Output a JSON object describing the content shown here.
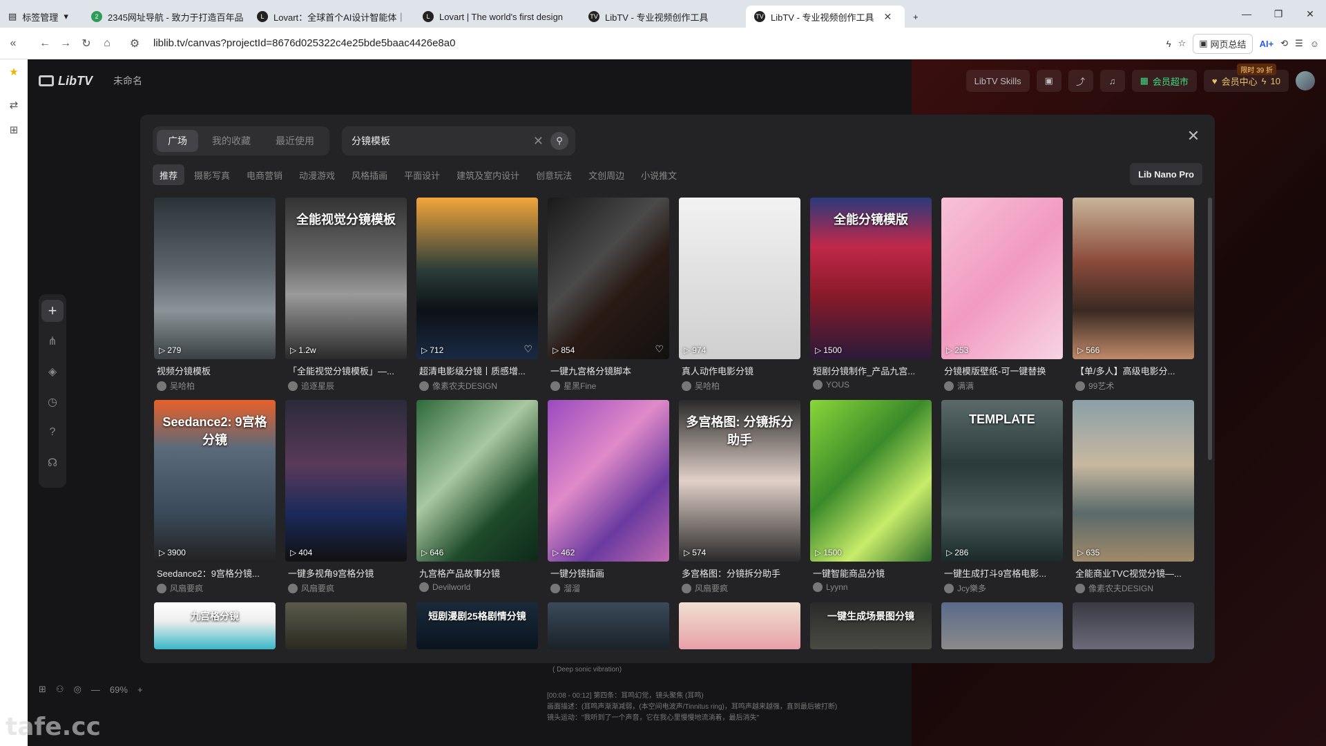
{
  "browser": {
    "tabs": [
      {
        "label": "标签管理",
        "favicon": ""
      },
      {
        "label": "2345网址导航 - 致力于打造百年品",
        "favicon": "2"
      },
      {
        "label": "Lovart：全球首个AI设计智能体｜",
        "favicon": "L"
      },
      {
        "label": "Lovart | The world's first design",
        "favicon": "L"
      },
      {
        "label": "LibTV - 专业视频创作工具",
        "favicon": "TV"
      },
      {
        "label": "LibTV - 专业视频创作工具",
        "favicon": "TV"
      }
    ],
    "url": "liblib.tv/canvas?projectId=8676d025322c4e25bde5baac4426e8a0",
    "web_summary": "网页总结",
    "ai_label": "AI+"
  },
  "app": {
    "logo": "LibTV",
    "project_name": "未命名",
    "skills": "LibTV Skills",
    "vip": "会员超市",
    "member_center": "会员中心",
    "credits": "10",
    "badge": "限时 39 折",
    "zoom": "69%",
    "bg_text_1": "( Deep sonic vibration)",
    "bg_text_2": "[00:08 - 00:12] 第四条：耳鸣幻觉，镜头聚焦 (耳鸣)",
    "bg_text_3": "画面描述：(耳鸣声渐渐减弱，(本空间电波声/Tinnitus ring)，耳鸣声越来越强，直到最后被打断)",
    "bg_text_4": "镜头运动：\"我听到了一个声音，它在我心里慢慢地流淌着，最后消失\"",
    "watermark": "tafe.cc"
  },
  "modal": {
    "tabs": [
      "广场",
      "我的收藏",
      "最近使用"
    ],
    "search_value": "分镜模板",
    "categories": [
      "推荐",
      "摄影写真",
      "电商营销",
      "动漫游戏",
      "风格插画",
      "平面设计",
      "建筑及室内设计",
      "创意玩法",
      "文创周边",
      "小说推文"
    ],
    "model": "Lib Nano Pro",
    "cards": [
      {
        "title": "视频分镜模板",
        "author": "吴哈柏",
        "stat": "279",
        "bg": "linear-gradient(180deg,#2c3338,#5c656b 45%,#8b9498 70%,#3a4044)",
        "overlay": ""
      },
      {
        "title": "「全能视觉分镜模板」—...",
        "author": "追逐星辰",
        "stat": "1.2w",
        "bg": "linear-gradient(180deg,#333,#6a6a6a 40%,#9a9a9a 60%,#2a2a2a)",
        "overlay": "全能视觉分镜模板"
      },
      {
        "title": "超清电影级分镜丨质感增...",
        "author": "像素农夫DESIGN",
        "stat": "712",
        "bg": "linear-gradient(180deg,#f2a63c,#2a3c38 45%,#0c1116 70%,#1a2a44)",
        "overlay": ""
      },
      {
        "title": "一键九宫格分镜脚本",
        "author": "星黑Fine",
        "stat": "854",
        "bg": "linear-gradient(135deg,#1a1a1a,#4a4a4a 40%,#2a1a14 60%,#111)",
        "overlay": ""
      },
      {
        "title": "真人动作电影分镜",
        "author": "吴哈柏",
        "stat": "974",
        "bg": "linear-gradient(180deg,#f2f2f2,#e0e0e0 50%,#cfcfcf)",
        "overlay": ""
      },
      {
        "title": "短剧分镜制作_产品九宫...",
        "author": "YOUS",
        "stat": "1500",
        "bg": "linear-gradient(180deg,#2a3a7a,#c0284a 30%,#8a1a2a 60%,#2a1a3a)",
        "overlay": "全能分镜模版"
      },
      {
        "title": "分镜模版壁纸-可一键替换",
        "author": "满满",
        "stat": "253",
        "bg": "linear-gradient(135deg,#f7c2d8,#f29ac0 50%,#f7d4e4)",
        "overlay": ""
      },
      {
        "title": "【单/多人】高级电影分...",
        "author": "99艺术",
        "stat": "566",
        "bg": "linear-gradient(180deg,#c8b49a,#8a4a3a 40%,#3a2a22 70%,#c08a6a)",
        "overlay": ""
      },
      {
        "title": "Seedance2：9宫格分镜...",
        "author": "风扇要疯",
        "stat": "3900",
        "bg": "linear-gradient(180deg,#e8602a,#5a6a7a 30%,#3a4a5a 70%,#222)",
        "overlay": "Seedance2: 9宫格分镜"
      },
      {
        "title": "一键多视角9宫格分镜",
        "author": "风扇要疯",
        "stat": "404",
        "bg": "linear-gradient(180deg,#2a2a3a,#5a3a5a 40%,#1a2a5a 70%,#111)",
        "overlay": ""
      },
      {
        "title": "九宫格产品故事分镜",
        "author": "Devilworld",
        "stat": "646",
        "bg": "linear-gradient(135deg,#2e6a3a,#a8c8a0 40%,#1e4a2a 70%,#0e2a1a)",
        "overlay": ""
      },
      {
        "title": "一键分镜插画",
        "author": "溜溜",
        "stat": "462",
        "bg": "linear-gradient(135deg,#9a4ac0,#e08ac8 40%,#6a3aa0 70%,#c06ab0)",
        "overlay": ""
      },
      {
        "title": "多宫格图：分镜拆分助手",
        "author": "风扇要疯",
        "stat": "574",
        "bg": "linear-gradient(180deg,#2a2a2a,#e0d0c8 50%,#2a2a2a)",
        "overlay": "多宫格图: 分镜拆分助手"
      },
      {
        "title": "一键智能商品分镜",
        "author": "Lyynn",
        "stat": "1500",
        "bg": "linear-gradient(135deg,#8ad63a,#3a8a2a 40%,#c8ec6a 70%,#2a6a2a)",
        "overlay": ""
      },
      {
        "title": "一键生成打斗9宫格电影...",
        "author": "Jcy樂多",
        "stat": "286",
        "bg": "linear-gradient(180deg,#5a6a6a,#2a3a3a 40%,#4a5a5a 70%,#1a2a2a)",
        "overlay": "TEMPLATE"
      },
      {
        "title": "全能商业TVC视觉分镜—...",
        "author": "像素农夫DESIGN",
        "stat": "635",
        "bg": "linear-gradient(180deg,#8aa0a8,#c8b8a0 40%,#5a6a6a 70%,#a08a6a)",
        "overlay": ""
      },
      {
        "title": "",
        "author": "",
        "stat": "",
        "bg": "linear-gradient(180deg,#fff,#eee 40%,#3ab8c8)",
        "overlay": "九宫格分镜"
      },
      {
        "title": "",
        "author": "",
        "stat": "",
        "bg": "linear-gradient(180deg,#5a5a4a,#2a2a22)",
        "overlay": ""
      },
      {
        "title": "",
        "author": "",
        "stat": "",
        "bg": "linear-gradient(180deg,#1a2a3a,#0a1420)",
        "overlay": "短剧漫剧25格剧情分镜"
      },
      {
        "title": "",
        "author": "",
        "stat": "",
        "bg": "linear-gradient(180deg,#3a4a5a,#1a222a)",
        "overlay": ""
      },
      {
        "title": "",
        "author": "",
        "stat": "",
        "bg": "linear-gradient(180deg,#f0e0d0,#e8a0a8)",
        "overlay": ""
      },
      {
        "title": "",
        "author": "",
        "stat": "",
        "bg": "linear-gradient(180deg,#2a2a2a,#4a4a44)",
        "overlay": "一键生成场景图分镜"
      },
      {
        "title": "",
        "author": "",
        "stat": "",
        "bg": "linear-gradient(180deg,#5a6a8a,#8a8a8a)",
        "overlay": ""
      },
      {
        "title": "",
        "author": "",
        "stat": "",
        "bg": "linear-gradient(180deg,#3a3a44,#6a6a7a)",
        "overlay": ""
      }
    ]
  }
}
